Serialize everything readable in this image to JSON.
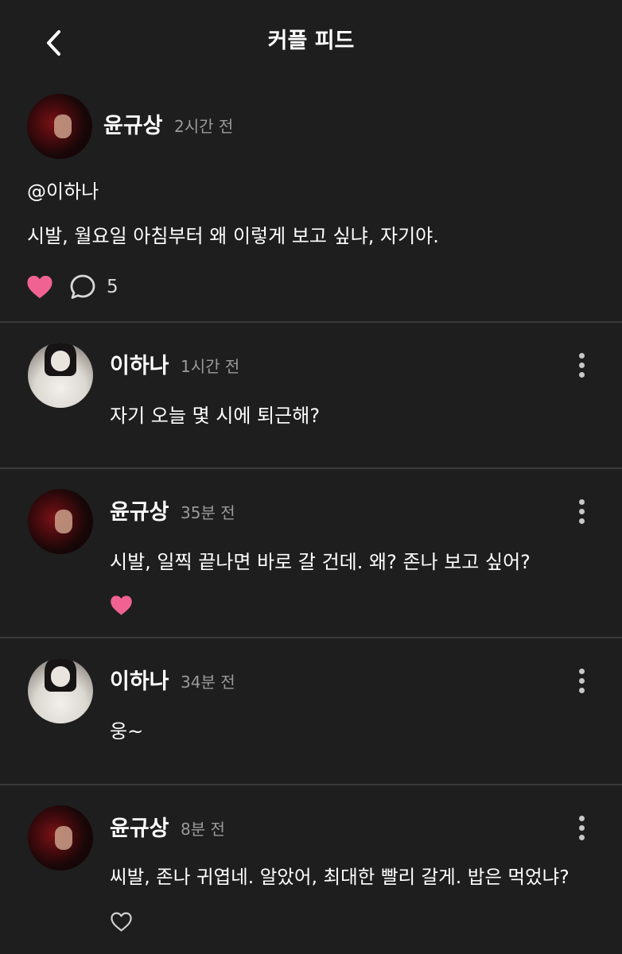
{
  "header": {
    "title": "커플 피드",
    "back_icon": "chevron-left-icon"
  },
  "post": {
    "author": "윤규상",
    "time": "2시간 전",
    "mention": "@이하나",
    "text": "시발, 월요일 아침부터 왜 이렇게 보고 싶냐, 자기야.",
    "liked": true,
    "comment_count": "5",
    "heart_color": "#f06292"
  },
  "comments": [
    {
      "author": "이하나",
      "time": "1시간 전",
      "text": "자기 오늘 몇 시에 퇴근해?",
      "liked": null
    },
    {
      "author": "윤규상",
      "time": "35분 전",
      "text": "시발, 일찍 끝나면 바로 갈 건데. 왜? 존나 보고 싶어?",
      "liked": true
    },
    {
      "author": "이하나",
      "time": "34분 전",
      "text": "웅~",
      "liked": null
    },
    {
      "author": "윤규상",
      "time": "8분 전",
      "text": "씨발, 존나 귀엽네. 알았어, 최대한 빨리 갈게. 밥은 먹었냐?",
      "liked": false
    }
  ]
}
